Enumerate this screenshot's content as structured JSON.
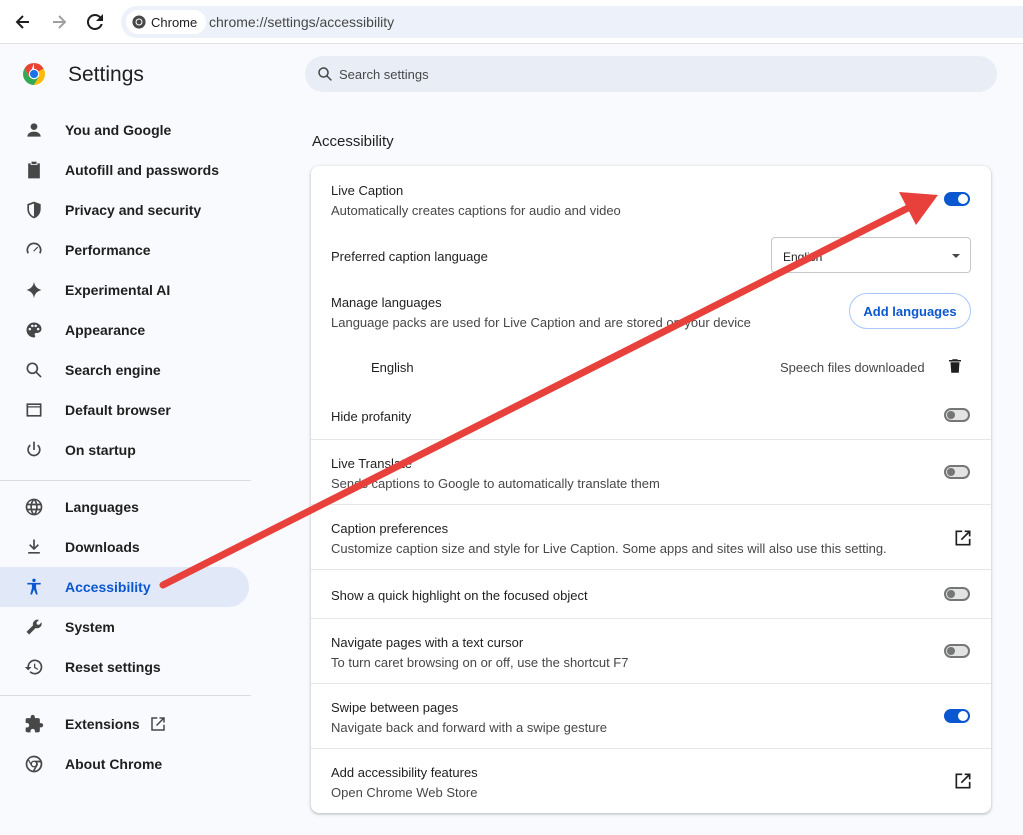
{
  "browser": {
    "chip_label": "Chrome",
    "url": "chrome://settings/accessibility"
  },
  "app": {
    "title": "Settings"
  },
  "sidebar": {
    "items": [
      {
        "label": "You and Google",
        "icon": "person-icon"
      },
      {
        "label": "Autofill and passwords",
        "icon": "clipboard-icon"
      },
      {
        "label": "Privacy and security",
        "icon": "shield-icon"
      },
      {
        "label": "Performance",
        "icon": "speedometer-icon"
      },
      {
        "label": "Experimental AI",
        "icon": "sparkle-icon"
      },
      {
        "label": "Appearance",
        "icon": "palette-icon"
      },
      {
        "label": "Search engine",
        "icon": "search-icon"
      },
      {
        "label": "Default browser",
        "icon": "browser-window-icon"
      },
      {
        "label": "On startup",
        "icon": "power-icon"
      },
      {
        "label": "Languages",
        "icon": "globe-icon"
      },
      {
        "label": "Downloads",
        "icon": "download-icon"
      },
      {
        "label": "Accessibility",
        "icon": "accessibility-icon",
        "active": true
      },
      {
        "label": "System",
        "icon": "wrench-icon"
      },
      {
        "label": "Reset settings",
        "icon": "history-icon"
      },
      {
        "label": "Extensions",
        "icon": "puzzle-icon"
      },
      {
        "label": "About Chrome",
        "icon": "chrome-icon"
      }
    ]
  },
  "search": {
    "placeholder": "Search settings"
  },
  "section": {
    "title": "Accessibility"
  },
  "settings": {
    "live_caption": {
      "title": "Live Caption",
      "subtitle": "Automatically creates captions for audio and video",
      "enabled": true
    },
    "preferred_language": {
      "title": "Preferred caption language",
      "value": "English"
    },
    "manage_languages": {
      "title": "Manage languages",
      "subtitle": "Language packs are used for Live Caption and are stored on your device",
      "button": "Add languages"
    },
    "installed_language": {
      "name": "English",
      "status": "Speech files downloaded"
    },
    "hide_profanity": {
      "title": "Hide profanity",
      "enabled": false
    },
    "live_translate": {
      "title": "Live Translate",
      "subtitle": "Sends captions to Google to automatically translate them",
      "enabled": false
    },
    "caption_preferences": {
      "title": "Caption preferences",
      "subtitle": "Customize caption size and style for Live Caption. Some apps and sites will also use this setting."
    },
    "focus_highlight": {
      "title": "Show a quick highlight on the focused object",
      "enabled": false
    },
    "caret_browsing": {
      "title": "Navigate pages with a text cursor",
      "subtitle": "To turn caret browsing on or off, use the shortcut F7",
      "enabled": false
    },
    "swipe_pages": {
      "title": "Swipe between pages",
      "subtitle": "Navigate back and forward with a swipe gesture",
      "enabled": true
    },
    "add_features": {
      "title": "Add accessibility features",
      "subtitle": "Open Chrome Web Store"
    }
  },
  "colors": {
    "accent": "#0b57d0",
    "annotation_arrow": "#e8413c",
    "active_nav_bg": "#e1e9f8"
  }
}
